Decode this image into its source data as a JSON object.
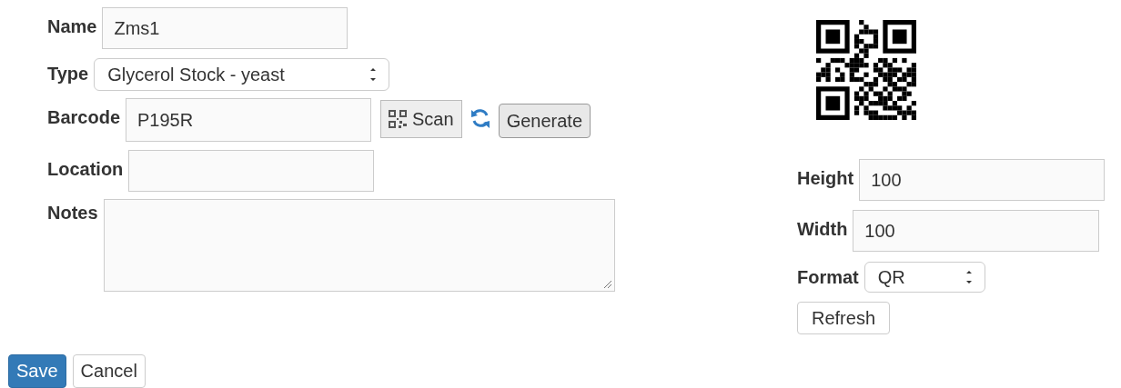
{
  "form": {
    "fields": [
      {
        "kind": "text",
        "label": "Name",
        "value": "Zms1"
      },
      {
        "kind": "select",
        "label": "Type",
        "value": "Glycerol Stock - yeast"
      },
      {
        "kind": "barcode",
        "label": "Barcode",
        "value": "P195R",
        "scan_button": "Scan",
        "generate_button": "Generate"
      },
      {
        "kind": "text",
        "label": "Location"
      },
      {
        "kind": "textarea",
        "label": "Notes"
      }
    ]
  },
  "barcode_settings": {
    "fields": [
      {
        "kind": "text",
        "label": "Height",
        "value": "100"
      },
      {
        "kind": "text",
        "label": "Width",
        "value": "100"
      },
      {
        "kind": "select",
        "label": "Format",
        "value": "QR"
      }
    ],
    "refresh_button": "Refresh"
  },
  "actions": [
    {
      "label": "Save",
      "primary": true
    },
    {
      "label": "Cancel",
      "primary": false
    }
  ]
}
